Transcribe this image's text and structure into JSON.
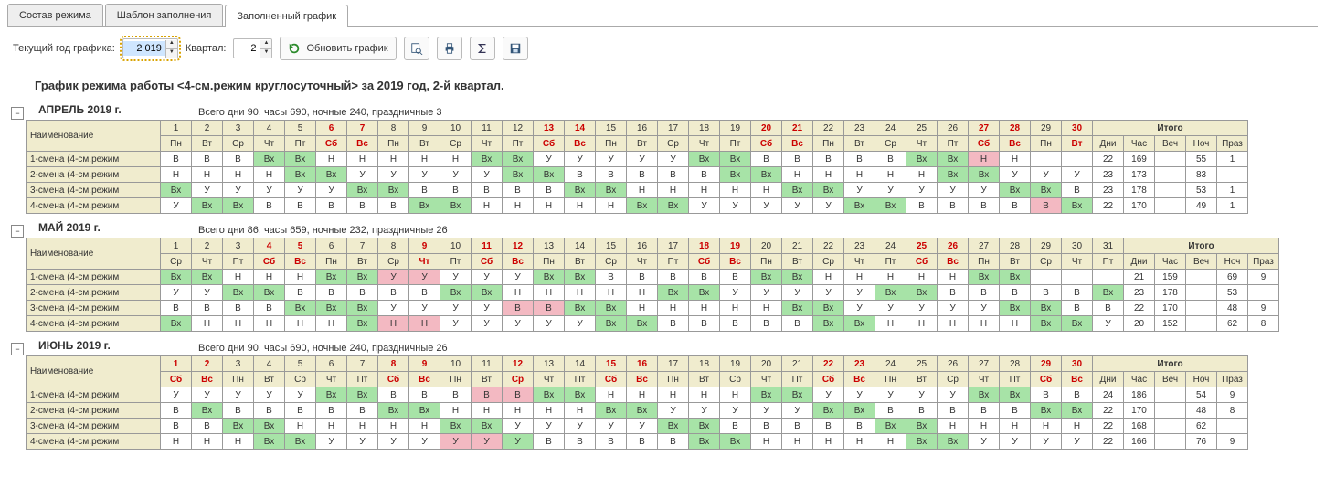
{
  "tabs": {
    "t1": "Состав режима",
    "t2": "Шаблон заполнения",
    "t3": "Заполненный график"
  },
  "toolbar": {
    "year_label": "Текущий год графика:",
    "year": "2 019",
    "quarter_label": "Квартал:",
    "quarter": "2",
    "refresh": "Обновить график"
  },
  "title": "График режима работы <4-см.режим круглосуточный> за 2019 год, 2-й квартал.",
  "itogo_hdr": {
    "main": "Итого",
    "dni": "Дни",
    "chas": "Час",
    "vech": "Веч",
    "noch": "Ноч",
    "praz": "Праз"
  },
  "name_hdr": "Наименование",
  "months": [
    {
      "title": "АПРЕЛЬ 2019 г.",
      "summary": "Всего дни 90, часы 690, ночные 240, праздничные 3",
      "days": [
        "1",
        "2",
        "3",
        "4",
        "5",
        "6",
        "7",
        "8",
        "9",
        "10",
        "11",
        "12",
        "13",
        "14",
        "15",
        "16",
        "17",
        "18",
        "19",
        "20",
        "21",
        "22",
        "23",
        "24",
        "25",
        "26",
        "27",
        "28",
        "29",
        "30"
      ],
      "red_days": [
        6,
        7,
        13,
        14,
        20,
        21,
        27,
        28,
        30
      ],
      "dow": [
        "Пн",
        "Вт",
        "Ср",
        "Чт",
        "Пт",
        "Сб",
        "Вс",
        "Пн",
        "Вт",
        "Ср",
        "Чт",
        "Пт",
        "Сб",
        "Вс",
        "Пн",
        "Вт",
        "Ср",
        "Чт",
        "Пт",
        "Сб",
        "Вс",
        "Пн",
        "Вт",
        "Ср",
        "Чт",
        "Пт",
        "Сб",
        "Вс",
        "Пн",
        "Вт"
      ],
      "rows": [
        {
          "name": "1-смена (4-см.режим",
          "c": [
            "В",
            "В",
            "В",
            "Вх",
            "Вх",
            "Н",
            "Н",
            "Н",
            "Н",
            "Н",
            "Вх",
            "Вх",
            "У",
            "У",
            "У",
            "У",
            "У",
            "Вх",
            "Вх",
            "В",
            "В",
            "В",
            "В",
            "В",
            "Вх",
            "Вх",
            "Н",
            "Н"
          ],
          "cls": [
            "",
            "",
            "",
            "grn",
            "grn",
            "",
            "",
            "",
            "",
            "",
            "grn",
            "grn",
            "",
            "",
            "",
            "",
            "",
            "grn",
            "grn",
            "",
            "",
            "",
            "",
            "",
            "grn",
            "grn",
            "pnk",
            ""
          ],
          "t": [
            "22",
            "169",
            "",
            "55",
            "1"
          ],
          "ncols": 28,
          "offset": 0,
          "extra": [
            "",
            ""
          ]
        },
        {
          "name": "2-смена (4-см.режим",
          "c": [
            "Н",
            "Н",
            "Н",
            "Н",
            "Вх",
            "Вх",
            "У",
            "У",
            "У",
            "У",
            "У",
            "Вх",
            "Вх",
            "В",
            "В",
            "В",
            "В",
            "В",
            "Вх",
            "Вх",
            "Н",
            "Н",
            "Н",
            "Н",
            "Н",
            "Вх",
            "Вх",
            "У",
            "У",
            "У"
          ],
          "cls": [
            "",
            "",
            "",
            "",
            "grn",
            "grn",
            "",
            "",
            "",
            "",
            "",
            "grn",
            "grn",
            "",
            "",
            "",
            "",
            "",
            "grn",
            "grn",
            "",
            "",
            "",
            "",
            "",
            "grn",
            "grn",
            "",
            "",
            ""
          ],
          "t": [
            "23",
            "173",
            "",
            "83",
            ""
          ]
        },
        {
          "name": "3-смена (4-см.режим",
          "c": [
            "Вх",
            "У",
            "У",
            "У",
            "У",
            "У",
            "Вх",
            "Вх",
            "В",
            "В",
            "В",
            "В",
            "В",
            "Вх",
            "Вх",
            "Н",
            "Н",
            "Н",
            "Н",
            "Н",
            "Вх",
            "Вх",
            "У",
            "У",
            "У",
            "У",
            "У",
            "Вх",
            "Вх",
            "В"
          ],
          "cls": [
            "grn",
            "",
            "",
            "",
            "",
            "",
            "grn",
            "grn",
            "",
            "",
            "",
            "",
            "",
            "grn",
            "grn",
            "",
            "",
            "",
            "",
            "",
            "grn",
            "grn",
            "",
            "",
            "",
            "",
            "",
            "grn",
            "grn",
            ""
          ],
          "t": [
            "23",
            "178",
            "",
            "53",
            "1"
          ]
        },
        {
          "name": "4-смена (4-см.режим",
          "c": [
            "У",
            "Вх",
            "Вх",
            "В",
            "В",
            "В",
            "В",
            "В",
            "Вх",
            "Вх",
            "Н",
            "Н",
            "Н",
            "Н",
            "Н",
            "Вх",
            "Вх",
            "У",
            "У",
            "У",
            "У",
            "У",
            "Вх",
            "Вх",
            "В",
            "В",
            "В",
            "В",
            "В",
            "Вх"
          ],
          "cls": [
            "",
            "grn",
            "grn",
            "",
            "",
            "",
            "",
            "",
            "grn",
            "grn",
            "",
            "",
            "",
            "",
            "",
            "grn",
            "grn",
            "",
            "",
            "",
            "",
            "",
            "grn",
            "grn",
            "",
            "",
            "",
            "",
            "pnk",
            "grn"
          ],
          "t": [
            "22",
            "170",
            "",
            "49",
            "1"
          ]
        }
      ]
    },
    {
      "title": "МАЙ 2019 г.",
      "summary": "Всего дни 86, часы 659, ночные 232, праздничные 26",
      "days": [
        "1",
        "2",
        "3",
        "4",
        "5",
        "6",
        "7",
        "8",
        "9",
        "10",
        "11",
        "12",
        "13",
        "14",
        "15",
        "16",
        "17",
        "18",
        "19",
        "20",
        "21",
        "22",
        "23",
        "24",
        "25",
        "26",
        "27",
        "28",
        "29",
        "30",
        "31"
      ],
      "red_days": [
        4,
        5,
        9,
        11,
        12,
        18,
        19,
        25,
        26
      ],
      "dow": [
        "Ср",
        "Чт",
        "Пт",
        "Сб",
        "Вс",
        "Пн",
        "Вт",
        "Ср",
        "Чт",
        "Пт",
        "Сб",
        "Вс",
        "Пн",
        "Вт",
        "Ср",
        "Чт",
        "Пт",
        "Сб",
        "Вс",
        "Пн",
        "Вт",
        "Ср",
        "Чт",
        "Пт",
        "Сб",
        "Вс",
        "Пн",
        "Вт",
        "Ср",
        "Чт",
        "Пт"
      ],
      "rows": [
        {
          "name": "1-смена (4-см.режим",
          "c": [
            "Вх",
            "Вх",
            "Н",
            "Н",
            "Н",
            "Вх",
            "Вх",
            "У",
            "У",
            "У",
            "У",
            "У",
            "Вх",
            "Вх",
            "В",
            "В",
            "В",
            "В",
            "В",
            "Вх",
            "Вх",
            "Н",
            "Н",
            "Н",
            "Н",
            "Н",
            "Вх",
            "Вх"
          ],
          "cls": [
            "grn",
            "grn",
            "",
            "",
            "",
            "grn",
            "grn",
            "pnk",
            "pnk",
            "",
            "",
            "",
            "grn",
            "grn",
            "",
            "",
            "",
            "",
            "",
            "grn",
            "grn",
            "",
            "",
            "",
            "",
            "",
            "grn",
            "grn"
          ],
          "offset": 0,
          "extra": [
            "",
            "",
            ""
          ],
          "t": [
            "21",
            "159",
            "",
            "69",
            "9"
          ]
        },
        {
          "name": "2-смена (4-см.режим",
          "c": [
            "У",
            "У",
            "Вх",
            "Вх",
            "В",
            "В",
            "В",
            "В",
            "В",
            "Вх",
            "Вх",
            "Н",
            "Н",
            "Н",
            "Н",
            "Н",
            "Вх",
            "Вх",
            "У",
            "У",
            "У",
            "У",
            "У",
            "Вх",
            "Вх",
            "В",
            "В",
            "В",
            "В",
            "В",
            "Вх"
          ],
          "cls": [
            "",
            "",
            "grn",
            "grn",
            "",
            "",
            "",
            "",
            "",
            "grn",
            "grn",
            "",
            "",
            "",
            "",
            "",
            "grn",
            "grn",
            "",
            "",
            "",
            "",
            "",
            "grn",
            "grn",
            "",
            "",
            "",
            "",
            "",
            "grn"
          ],
          "t": [
            "23",
            "178",
            "",
            "53",
            ""
          ]
        },
        {
          "name": "3-смена (4-см.режим",
          "c": [
            "Вх",
            "Вх",
            "Вх",
            "У",
            "У",
            "У",
            "У",
            "В",
            "В",
            "Вх",
            "Вх",
            "Н",
            "Н",
            "Н",
            "Н",
            "Н",
            "Вх",
            "Вх",
            "У",
            "У",
            "У",
            "У",
            "У",
            "Вх",
            "Вх",
            "В",
            "В"
          ],
          "cls": [
            "grn",
            "grn",
            "grn",
            "",
            "",
            "",
            "",
            "pnk",
            "pnk",
            "grn",
            "grn",
            "",
            "",
            "",
            "",
            "",
            "grn",
            "grn",
            "",
            "",
            "",
            "",
            "",
            "grn",
            "grn",
            "",
            ""
          ],
          "offset": 4,
          "extra": [
            "",
            "",
            "",
            ""
          ],
          "c2": [
            "В",
            "В",
            "В",
            "В"
          ],
          "cls2": [
            "",
            "",
            "",
            ""
          ],
          "t": [
            "22",
            "170",
            "",
            "48",
            "9"
          ]
        },
        {
          "name": "4-смена (4-см.режим",
          "c": [
            "Вх",
            "Н",
            "Н",
            "Н",
            "Н",
            "Н",
            "Вх",
            "Н",
            "Н",
            "У",
            "У",
            "У",
            "У",
            "У",
            "Вх",
            "Вх",
            "В",
            "В",
            "В",
            "В",
            "В",
            "Вх",
            "Вх",
            "Н",
            "Н",
            "Н",
            "Н",
            "Н",
            "Вх",
            "Вх",
            "У"
          ],
          "cls": [
            "grn",
            "",
            "",
            "",
            "",
            "",
            "grn",
            "pnk",
            "pnk",
            "",
            "",
            "",
            "",
            "",
            "grn",
            "grn",
            "",
            "",
            "",
            "",
            "",
            "grn",
            "grn",
            "",
            "",
            "",
            "",
            "",
            "grn",
            "grn",
            ""
          ],
          "t": [
            "20",
            "152",
            "",
            "62",
            "8"
          ]
        }
      ]
    },
    {
      "title": "ИЮНЬ 2019 г.",
      "summary": "Всего дни 90, часы 690, ночные 240, праздничные 26",
      "days": [
        "1",
        "2",
        "3",
        "4",
        "5",
        "6",
        "7",
        "8",
        "9",
        "10",
        "11",
        "12",
        "13",
        "14",
        "15",
        "16",
        "17",
        "18",
        "19",
        "20",
        "21",
        "22",
        "23",
        "24",
        "25",
        "26",
        "27",
        "28",
        "29",
        "30"
      ],
      "red_days": [
        1,
        2,
        8,
        9,
        12,
        15,
        16,
        22,
        23,
        29,
        30
      ],
      "dow": [
        "Сб",
        "Вс",
        "Пн",
        "Вт",
        "Ср",
        "Чт",
        "Пт",
        "Сб",
        "Вс",
        "Пн",
        "Вт",
        "Ср",
        "Чт",
        "Пт",
        "Сб",
        "Вс",
        "Пн",
        "Вт",
        "Ср",
        "Чт",
        "Пт",
        "Сб",
        "Вс",
        "Пн",
        "Вт",
        "Ср",
        "Чт",
        "Пт",
        "Сб",
        "Вс"
      ],
      "rows": [
        {
          "name": "1-смена (4-см.режим",
          "c": [
            "У",
            "У",
            "У",
            "У",
            "У",
            "Вх",
            "Вх",
            "В",
            "В",
            "В",
            "В",
            "В",
            "Вх",
            "Вх",
            "Н",
            "Н",
            "Н",
            "Н",
            "Н",
            "Вх",
            "Вх",
            "У",
            "У",
            "У",
            "У",
            "У",
            "Вх",
            "Вх",
            "В",
            "В"
          ],
          "cls": [
            "",
            "",
            "",
            "",
            "",
            "grn",
            "grn",
            "",
            "",
            "",
            "pnk",
            "pnk",
            "grn",
            "grn",
            "",
            "",
            "",
            "",
            "",
            "grn",
            "grn",
            "",
            "",
            "",
            "",
            "",
            "grn",
            "grn",
            "",
            ""
          ],
          "t": [
            "24",
            "186",
            "",
            "54",
            "9"
          ]
        },
        {
          "name": "2-смена (4-см.режим",
          "c": [
            "В",
            "Вх",
            "В",
            "В",
            "В",
            "В",
            "В",
            "Вх",
            "Вх",
            "Н",
            "Н",
            "Н",
            "Н",
            "Н",
            "Вх",
            "Вх",
            "У",
            "У",
            "У",
            "У",
            "У",
            "Вх",
            "Вх",
            "В",
            "В",
            "В",
            "В",
            "В",
            "Вх",
            "Вх"
          ],
          "cls": [
            "",
            "grn",
            "",
            "",
            "",
            "",
            "",
            "grn",
            "grn",
            "",
            "",
            "",
            "",
            "",
            "grn",
            "grn",
            "",
            "",
            "",
            "",
            "",
            "grn",
            "grn",
            "",
            "",
            "",
            "",
            "",
            "grn",
            "grn"
          ],
          "t": [
            "22",
            "170",
            "",
            "48",
            "8"
          ]
        },
        {
          "name": "3-смена (4-см.режим",
          "c": [
            "В",
            "В",
            "Вх",
            "Вх",
            "Н",
            "Н",
            "Н",
            "Н",
            "Н",
            "Вх",
            "Вх",
            "У",
            "У",
            "У",
            "У",
            "У",
            "Вх",
            "Вх",
            "В",
            "В",
            "В",
            "В",
            "В",
            "Вх",
            "Вх",
            "Н",
            "Н",
            "Н",
            "Н",
            "Н"
          ],
          "cls": [
            "",
            "",
            "grn",
            "grn",
            "",
            "",
            "",
            "",
            "",
            "grn",
            "grn",
            "",
            "",
            "",
            "",
            "",
            "grn",
            "grn",
            "",
            "",
            "",
            "",
            "",
            "grn",
            "grn",
            "",
            "",
            "",
            "",
            ""
          ],
          "t": [
            "22",
            "168",
            "",
            "62",
            ""
          ]
        },
        {
          "name": "4-смена (4-см.режим",
          "c": [
            "Н",
            "Н",
            "Н",
            "Вх",
            "Вх",
            "У",
            "У",
            "У",
            "У",
            "У",
            "У",
            "У",
            "В",
            "В",
            "В",
            "В",
            "В",
            "Вх",
            "Вх",
            "Н",
            "Н",
            "Н",
            "Н",
            "Н",
            "Вх",
            "Вх",
            "У",
            "У",
            "У",
            "У"
          ],
          "cls": [
            "",
            "",
            "",
            "grn",
            "grn",
            "",
            "",
            "",
            "",
            "pnk",
            "pnk",
            "grn",
            "",
            "",
            "",
            "",
            "",
            "grn",
            "grn",
            "",
            "",
            "",
            "",
            "",
            "grn",
            "grn",
            "",
            "",
            "",
            ""
          ],
          "t": [
            "22",
            "166",
            "",
            "76",
            "9"
          ]
        }
      ]
    }
  ]
}
